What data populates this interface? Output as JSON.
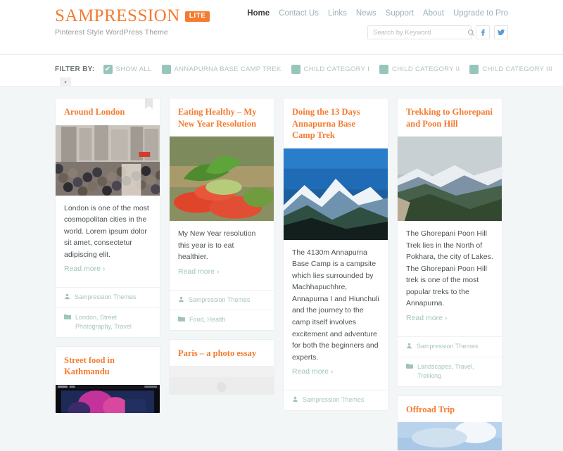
{
  "header": {
    "brand_name": "SAMPRESSION",
    "brand_badge": "LITE",
    "tagline": "Pinterest Style WordPress Theme",
    "nav": [
      {
        "label": "Home",
        "active": true
      },
      {
        "label": "Contact Us",
        "active": false
      },
      {
        "label": "Links",
        "active": false
      },
      {
        "label": "News",
        "active": false
      },
      {
        "label": "Support",
        "active": false
      },
      {
        "label": "About",
        "active": false
      },
      {
        "label": "Upgrade to Pro",
        "active": false
      }
    ],
    "search": {
      "placeholder": "Search by Keyword",
      "value": "",
      "icon": "search-icon"
    },
    "social": [
      {
        "name": "facebook-icon",
        "glyph": "f"
      },
      {
        "name": "twitter-icon",
        "glyph": "bird"
      }
    ],
    "accent_color": "#f47b30",
    "social_color": "#5b9bd5"
  },
  "filter": {
    "label": "FILTER BY:",
    "checkbox_color": "#97c5bb",
    "items": [
      {
        "label": "SHOW ALL",
        "checked": true
      },
      {
        "label": "ANNAPURNA BASE CAMP TREK",
        "checked": false
      },
      {
        "label": "CHILD CATEGORY I",
        "checked": false
      },
      {
        "label": "CHILD CATEGORY II",
        "checked": false
      },
      {
        "label": "CHILD CATEGORY III",
        "checked": false
      }
    ],
    "expand_icon": "chevron-down-icon"
  },
  "grid": {
    "read_more": "Read more ›",
    "author": "Sampression Themes",
    "columns": [
      {
        "cards": [
          {
            "title": "Around London",
            "sticky": true,
            "image": "london-crowd-street",
            "excerpt": "London is one of the most cosmopolitan cities in the world. Lorem ipsum dolor sit amet, consectetur adipiscing elit.",
            "author": "Sampression Themes",
            "categories": "London, Street Photography, Travel"
          },
          {
            "title": "Street food in Kathmandu",
            "sticky": false,
            "image": "kathmandu-night-street",
            "excerpt": "",
            "author": "",
            "categories": ""
          }
        ]
      },
      {
        "cards": [
          {
            "title": "Eating Healthy – My New Year Resolution",
            "sticky": false,
            "image": "tomato-basil-avocado",
            "excerpt": "My New Year resolution this year is to eat healthier.",
            "author": "Sampression Themes",
            "categories": "Food, Health"
          },
          {
            "title": "Paris – a photo essay",
            "sticky": false,
            "image": "paris-placeholder",
            "excerpt": "",
            "author": "",
            "categories": ""
          }
        ]
      },
      {
        "cards": [
          {
            "title": "Doing the 13 Days Annapurna Base Camp Trek",
            "sticky": false,
            "image": "annapurna-mountain",
            "excerpt": "The 4130m Annapurna Base Camp is a campsite which lies surrounded by Machhapuchhre, Annapurna I and Hiunchuli and the journey to the camp itself involves excitement and adventure for both the beginners and experts.",
            "author": "Sampression Themes",
            "categories": ""
          }
        ]
      },
      {
        "cards": [
          {
            "title": "Trekking to Ghorepani and Poon Hill",
            "sticky": false,
            "image": "ghorepani-hills",
            "excerpt": "The Ghorepani Poon Hill Trek lies in the North of Pokhara, the city of Lakes. The Ghorepani Poon Hill trek is one of the most popular treks to the Annapurna.",
            "author": "Sampression Themes",
            "categories": "Landscapes, Travel, Trekking"
          },
          {
            "title": "Offroad Trip",
            "sticky": false,
            "image": "offroad-sky",
            "excerpt": "",
            "author": "",
            "categories": ""
          }
        ]
      }
    ]
  }
}
